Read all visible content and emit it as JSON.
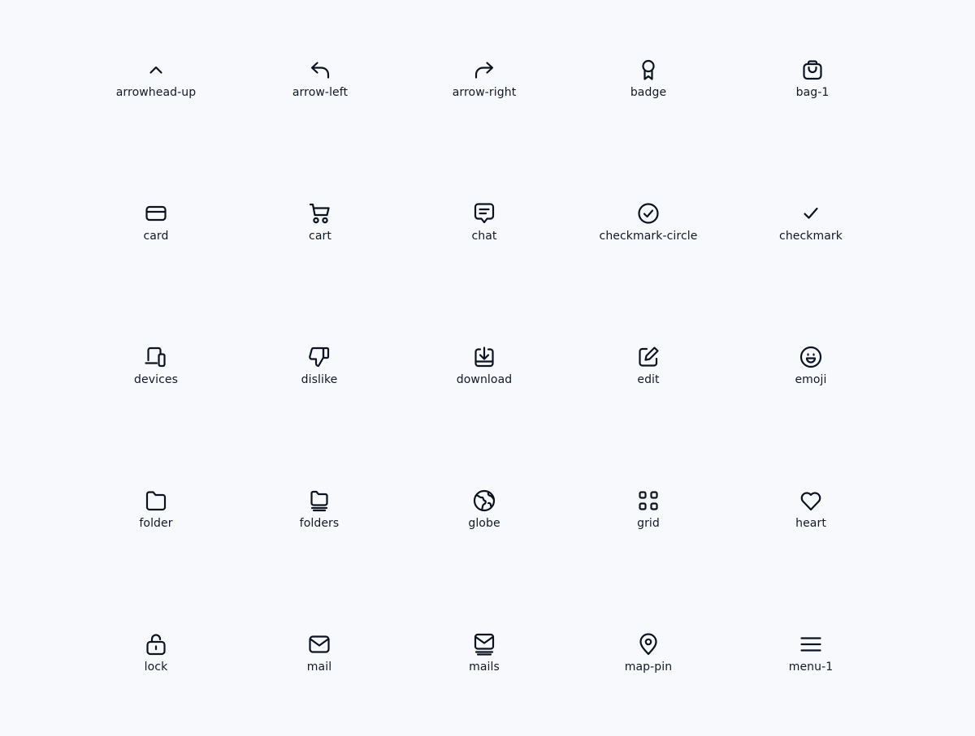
{
  "icons": [
    {
      "name": "arrowhead-up-icon",
      "label": "arrowhead-up"
    },
    {
      "name": "arrow-left-icon",
      "label": "arrow-left"
    },
    {
      "name": "arrow-right-icon",
      "label": "arrow-right"
    },
    {
      "name": "badge-icon",
      "label": "badge"
    },
    {
      "name": "bag-1-icon",
      "label": "bag-1"
    },
    {
      "name": "card-icon",
      "label": "card"
    },
    {
      "name": "cart-icon",
      "label": "cart"
    },
    {
      "name": "chat-icon",
      "label": "chat"
    },
    {
      "name": "checkmark-circle-icon",
      "label": "checkmark-circle"
    },
    {
      "name": "checkmark-icon",
      "label": "checkmark"
    },
    {
      "name": "devices-icon",
      "label": "devices"
    },
    {
      "name": "dislike-icon",
      "label": "dislike"
    },
    {
      "name": "download-icon",
      "label": "download"
    },
    {
      "name": "edit-icon",
      "label": "edit"
    },
    {
      "name": "emoji-icon",
      "label": "emoji"
    },
    {
      "name": "folder-icon",
      "label": "folder"
    },
    {
      "name": "folders-icon",
      "label": "folders"
    },
    {
      "name": "globe-icon",
      "label": "globe"
    },
    {
      "name": "grid-icon",
      "label": "grid"
    },
    {
      "name": "heart-icon",
      "label": "heart"
    },
    {
      "name": "lock-icon",
      "label": "lock"
    },
    {
      "name": "mail-icon",
      "label": "mail"
    },
    {
      "name": "mails-icon",
      "label": "mails"
    },
    {
      "name": "map-pin-icon",
      "label": "map-pin"
    },
    {
      "name": "menu-1-icon",
      "label": "menu-1"
    }
  ],
  "colors": {
    "background": "#f8f9fc",
    "icon_stroke": "#0b1220",
    "label_text": "#111827"
  }
}
